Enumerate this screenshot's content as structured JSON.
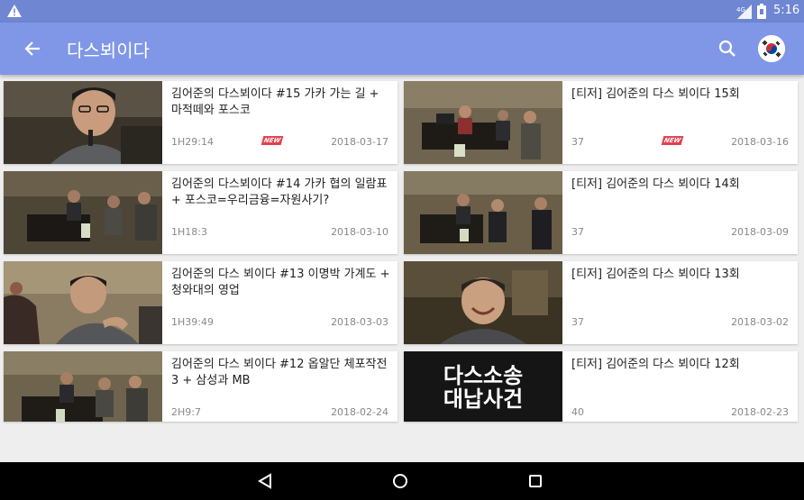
{
  "status_bar": {
    "time": "5:16"
  },
  "toolbar": {
    "title": "다스뵈이다",
    "flag_icon": "korea-flag-icon"
  },
  "videos": [
    {
      "title": "김어준의 다스뵈이다 #15 가카 가는 길 + 마적떼와 포스코",
      "meta": "1H29:14",
      "date": "2018-03-17",
      "is_new": true,
      "new_label": "NEW"
    },
    {
      "title": "[티저] 김어준의 다스 뵈이다 15회",
      "meta": "37",
      "date": "2018-03-16",
      "is_new": true,
      "new_label": "NEW"
    },
    {
      "title": "김어준의 다스뵈이다 #14 가카 협의 일람표 + 포스코=우리금융=자원사기?",
      "meta": "1H18:3",
      "date": "2018-03-10",
      "is_new": false
    },
    {
      "title": "[티저] 김어준의 다스 뵈이다 14회",
      "meta": "37",
      "date": "2018-03-09",
      "is_new": false
    },
    {
      "title": "김어준의 다스 뵈이다 #13 이명박 가계도 + 청와대의 영업",
      "meta": "1H39:49",
      "date": "2018-03-03",
      "is_new": false
    },
    {
      "title": "[티저] 김어준의 다스 뵈이다 13회",
      "meta": "37",
      "date": "2018-03-02",
      "is_new": false
    },
    {
      "title": "김어준의 다스 뵈이다 #12 옵알단 체포작전 3 + 삼성과 MB",
      "meta": "2H9:7",
      "date": "2018-02-24",
      "is_new": false
    },
    {
      "title": "[티저] 김어준의 다스 뵈이다 12회",
      "meta": "40",
      "date": "2018-02-23",
      "is_new": false,
      "thumb_text": [
        "다스소송",
        "대납사건"
      ]
    }
  ]
}
